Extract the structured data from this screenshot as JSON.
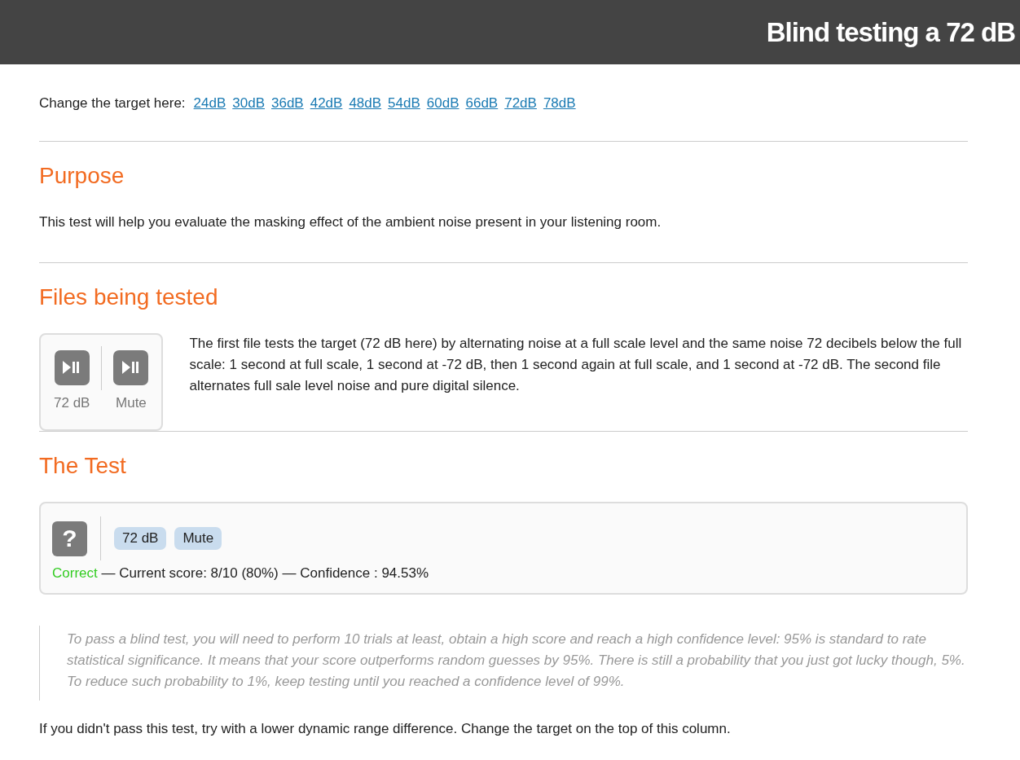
{
  "header": {
    "title": "Blind testing a 72 dB"
  },
  "target": {
    "label": "Change the target here:",
    "links": [
      "24dB",
      "30dB",
      "36dB",
      "42dB",
      "48dB",
      "54dB",
      "60dB",
      "66dB",
      "72dB",
      "78dB"
    ]
  },
  "sections": [
    {
      "heading": "Purpose",
      "text": "This test will help you evaluate the masking effect of the ambient noise present in your listening room."
    },
    {
      "heading": "Files being tested",
      "players": [
        {
          "label": "72 dB"
        },
        {
          "label": "Mute"
        }
      ],
      "text": "The first file tests the target (72 dB here) by alternating noise at a full scale level and the same noise 72 decibels below the full scale: 1 second at full scale, 1 second at -72 dB, then 1 second again at full scale, and 1 second at -72 dB. The second file alternates full sale level noise and pure digital silence."
    },
    {
      "heading": "The Test",
      "mystery": "?",
      "choices": [
        "72 dB",
        "Mute"
      ],
      "result": {
        "kind": "correct",
        "status": "Correct",
        "text": "— Current score: 8/10 (80%) — Confidence : 94.53%"
      }
    }
  ],
  "note": "To pass a blind test, you will need to perform 10 trials at least, obtain a high score and reach a high confidence level: 95% is standard to rate statistical significance. It means that your score outperforms random guesses by 95%. There is still a probability that you just got lucky though, 5%. To reduce such probability to 1%, keep testing until you reached a confidence level of 99%.",
  "footer": "If you didn't pass this test, try with a lower dynamic range difference. Change the target on the top of this column."
}
